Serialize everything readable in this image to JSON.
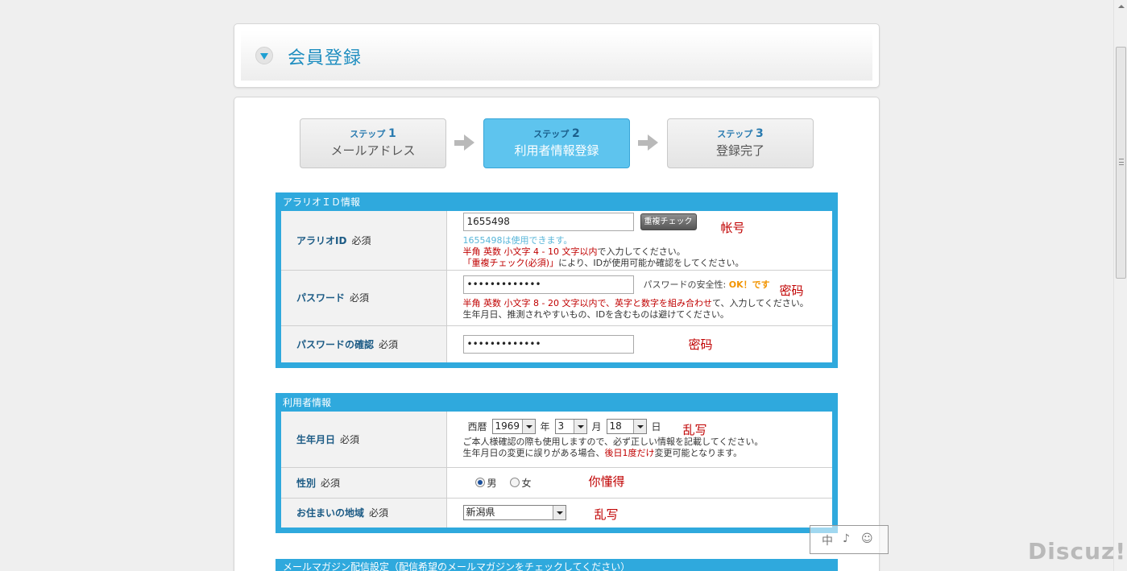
{
  "header": {
    "title": "会員登録"
  },
  "steps": [
    {
      "num": "ステップ",
      "digit": "1",
      "name": "メールアドレス"
    },
    {
      "num": "ステップ",
      "digit": "2",
      "name": "利用者情報登録"
    },
    {
      "num": "ステップ",
      "digit": "3",
      "name": "登録完了"
    }
  ],
  "section_id": {
    "title": "アラリオＩＤ情報",
    "id_label": "アラリオID",
    "required": "必須",
    "id_value": "1655498",
    "check_button": "重複チェック",
    "id_ok_note": "1655498は使用できます。",
    "id_rule_red": "半角 英数 小文字 4 - 10 文字以内",
    "id_rule_rest": "で入力してください。",
    "id_check_red": "「重複チェック(必須)」",
    "id_check_rest": "により、IDが使用可能か確認をしてください。",
    "annot_id": "帐号",
    "pw_label": "パスワード",
    "pw_value": "•••••••••••••",
    "pw_strength_label": "パスワードの安全性:",
    "pw_strength_value": "OK！です",
    "annot_pw": "密码",
    "pw_rule_red": "半角 英数 小文字 8 - 20 文字以内で、英字と数字を組み合わせ",
    "pw_rule_rest": "て、入力してください。",
    "pw_rule2": "生年月日、推測されやすいもの、IDを含むものは避けてください。",
    "pw_confirm_label": "パスワードの確認",
    "pw_confirm_value": "•••••••••••••",
    "annot_pw2": "密码"
  },
  "section_user": {
    "title": "利用者情報",
    "birth_label": "生年月日",
    "required": "必須",
    "era": "西暦",
    "year": "1969",
    "year_unit": "年",
    "month": "3",
    "month_unit": "月",
    "day": "18",
    "day_unit": "日",
    "annot_birth": "乱写",
    "birth_note1": "ご本人様確認の際も使用しますので、必ず正しい情報を記載してください。",
    "birth_note2_a": "生年月日の変更に誤りがある場合、",
    "birth_note2_red": "後日1度だけ",
    "birth_note2_b": "変更可能となります。",
    "gender_label": "性別",
    "gender_male": "男",
    "gender_female": "女",
    "annot_gender": "你懂得",
    "region_label": "お住まいの地域",
    "region_value": "新潟県",
    "annot_region": "乱写"
  },
  "section_mail": {
    "title": "メールマガジン配信設定（配信希望のメールマガジンをチェックしてください）"
  },
  "watermark": {
    "chars": [
      "中",
      "♪",
      "☺"
    ],
    "brand": "Discuz!"
  }
}
